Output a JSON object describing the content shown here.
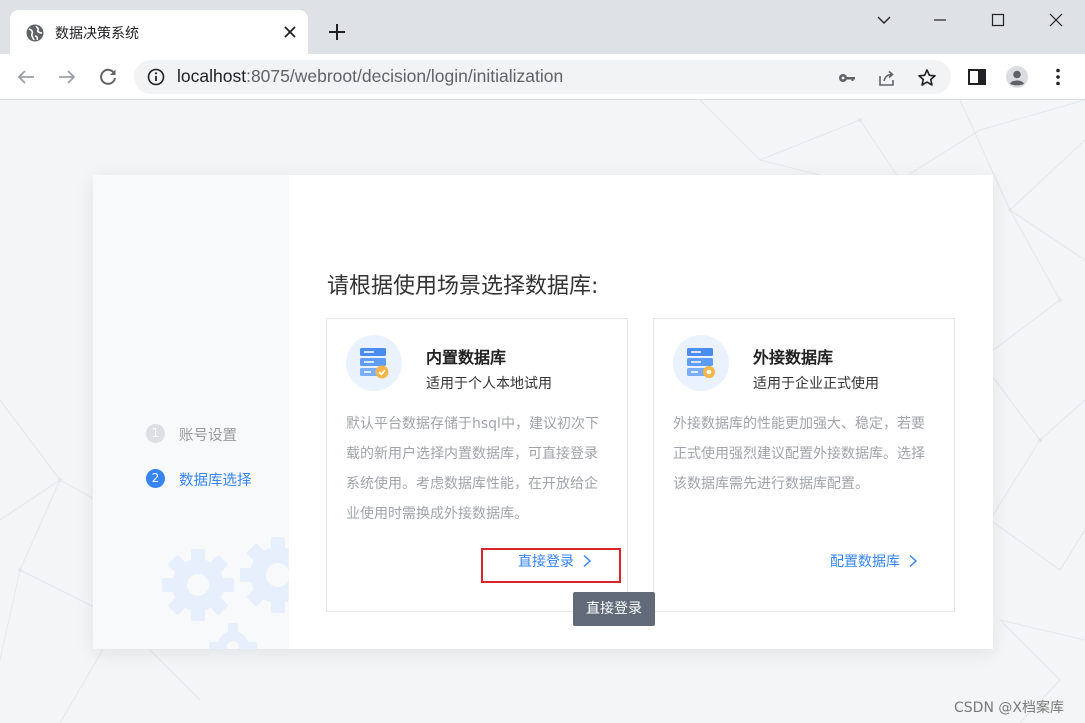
{
  "browser": {
    "tab_title": "数据决策系统",
    "url_host": "localhost",
    "url_rest": ":8075/webroot/decision/login/initialization"
  },
  "icons": {
    "tab": "globe-icon",
    "close": "close-icon",
    "new_tab": "plus-icon",
    "window": [
      "chevron-down-icon",
      "minimize-icon",
      "maximize-icon",
      "close-icon"
    ],
    "nav": [
      "back-arrow-icon",
      "forward-arrow-icon",
      "reload-icon"
    ],
    "omnibox": [
      "info-icon",
      "key-icon",
      "share-icon",
      "star-icon"
    ],
    "toolbar": [
      "side-panel-icon",
      "profile-icon",
      "menu-dots-icon"
    ]
  },
  "steps": [
    {
      "num": "1",
      "label": "账号设置",
      "active": false
    },
    {
      "num": "2",
      "label": "数据库选择",
      "active": true
    }
  ],
  "main": {
    "heading": "请根据使用场景选择数据库:",
    "cards": [
      {
        "title": "内置数据库",
        "subtitle": "适用于个人本地试用",
        "description": "默认平台数据存储于hsql中，建议初次下载的新用户选择内置数据库，可直接登录系统使用。考虑数据库性能，在开放给企业使用时需换成外接数据库。",
        "action": "直接登录"
      },
      {
        "title": "外接数据库",
        "subtitle": "适用于企业正式使用",
        "description": "外接数据库的性能更加强大、稳定，若要正式使用强烈建议配置外接数据库。选择该数据库需先进行数据库配置。",
        "action": "配置数据库"
      }
    ]
  },
  "tooltip": "直接登录",
  "watermark": "CSDN @X档案库",
  "colors": {
    "accent": "#3685f2",
    "highlight": "#d8262e",
    "tooltip_bg": "#606a78"
  }
}
